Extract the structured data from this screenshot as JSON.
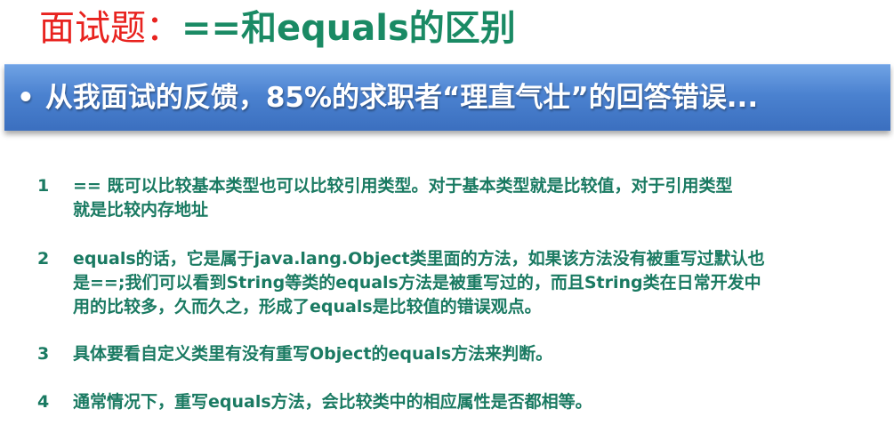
{
  "title": {
    "prefix": "面试题：",
    "main": "==和equals的区别"
  },
  "banner": {
    "bullet": "•",
    "text": "从我面试的反馈，85%的求职者“理直气壮”的回答错误..."
  },
  "items": [
    {
      "num": "1",
      "text": "== 既可以比较基本类型也可以比较引用类型。对于基本类型就是比较值，对于引用类型\n就是比较内存地址"
    },
    {
      "num": "2",
      "text": "equals的话，它是属于java.lang.Object类里面的方法，如果该方法没有被重写过默认也\n是==;我们可以看到String等类的equals方法是被重写过的，而且String类在日常开发中\n用的比较多，久而久之，形成了equals是比较值的错误观点。"
    },
    {
      "num": "3",
      "text": "具体要看自定义类里有没有重写Object的equals方法来判断。"
    },
    {
      "num": "4",
      "text": "通常情况下，重写equals方法，会比较类中的相应属性是否都相等。"
    }
  ]
}
